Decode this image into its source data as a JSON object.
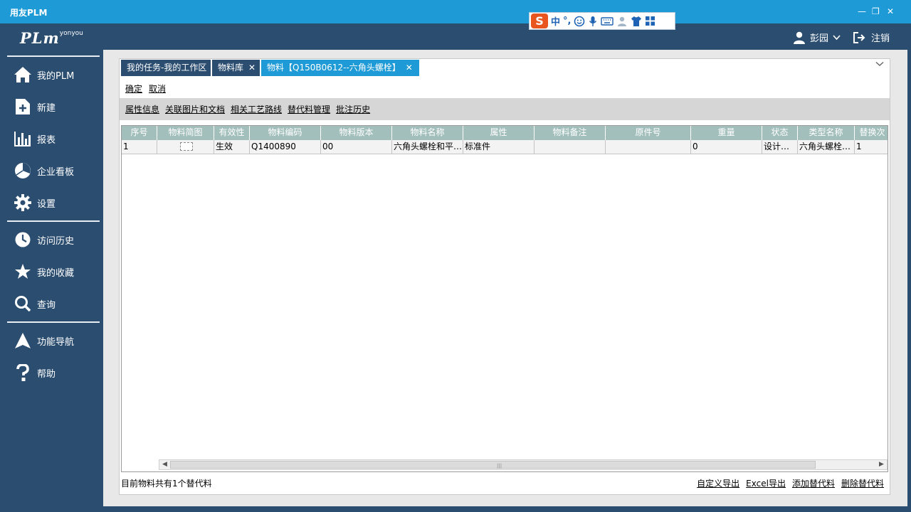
{
  "window": {
    "title": "用友PLM",
    "minimize": "—",
    "restore": "❐",
    "close": "✕"
  },
  "header": {
    "logo_text": "PLm",
    "logo_sup": "yonyou",
    "ime_logo": "S",
    "ime_lang": "中",
    "ime_punct": "°,",
    "user_name": "彭园",
    "logout_label": "注销"
  },
  "sidebar": {
    "items": [
      {
        "label": "我的PLM",
        "icon": "home-icon"
      },
      {
        "label": "新建",
        "icon": "new-document-icon"
      },
      {
        "label": "报表",
        "icon": "bar-chart-icon"
      },
      {
        "label": "企业看板",
        "icon": "pie-chart-icon"
      },
      {
        "label": "设置",
        "icon": "gear-icon"
      },
      {
        "label": "访问历史",
        "icon": "history-icon"
      },
      {
        "label": "我的收藏",
        "icon": "star-icon"
      },
      {
        "label": "查询",
        "icon": "search-icon"
      },
      {
        "label": "功能导航",
        "icon": "navigation-icon"
      },
      {
        "label": "帮助",
        "icon": "help-icon"
      }
    ]
  },
  "tabs": [
    {
      "label": "我的任务-我的工作区",
      "closable": false
    },
    {
      "label": "物料库",
      "closable": true
    },
    {
      "label": "物料【Q150B0612--六角头螺栓】",
      "closable": true,
      "active": true
    }
  ],
  "collapse_icon": "chevron-down-icon",
  "actions": {
    "confirm": "确定",
    "cancel": "取消"
  },
  "subtabs": [
    "属性信息",
    "关联图片和文档",
    "相关工艺路线",
    "替代料管理",
    "批注历史"
  ],
  "table": {
    "columns": [
      "序号",
      "物料简图",
      "有效性",
      "物料编码",
      "物料版本",
      "物料名称",
      "属性",
      "物料备注",
      "原件号",
      "重量",
      "状态",
      "类型名称",
      "替换次"
    ],
    "rows": [
      [
        "1",
        "",
        "生效",
        "Q1400890",
        "00",
        "六角头螺栓和平…",
        "标准件",
        "",
        "",
        "0",
        "设计状…",
        "六角头螺栓…",
        "1"
      ]
    ]
  },
  "footer": {
    "summary": "目前物料共有1个替代料",
    "links": [
      "自定义导出",
      "Excel导出",
      "添加替代料",
      "删除替代料"
    ]
  },
  "colors": {
    "titlebar": "#1e9ad6",
    "navy": "#2b4d70",
    "grid_header": "#a3bfbc",
    "active_tab": "#1e9ad6"
  }
}
